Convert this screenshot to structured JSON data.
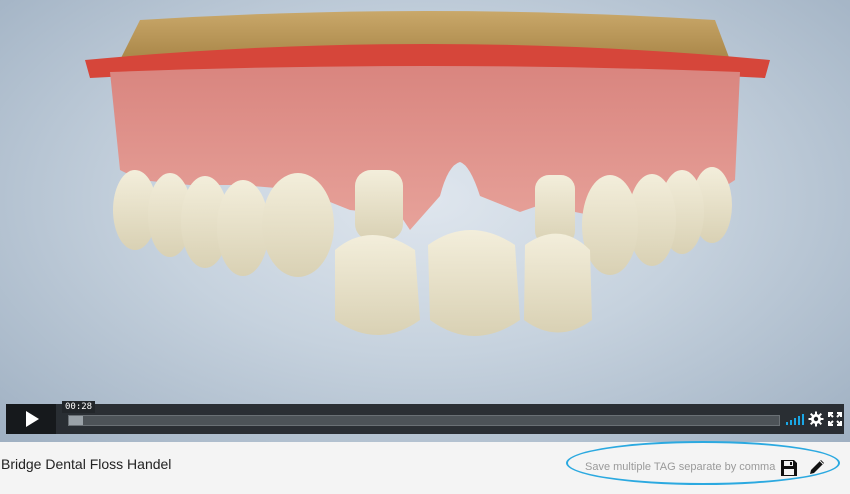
{
  "player": {
    "current_time": "00:28",
    "progress_fraction": 0.02,
    "volume_level": 1.0
  },
  "video": {
    "title": "Bridge Dental Floss Handel"
  },
  "tags": {
    "placeholder": "Save multiple TAG separate by comma",
    "value": ""
  },
  "icons": {
    "play": "play-icon",
    "volume": "volume-icon",
    "settings": "gear-icon",
    "fullscreen": "fullscreen-icon",
    "save": "floppy-disk-icon",
    "edit": "pencil-icon"
  },
  "colors": {
    "accent": "#2ba9e0",
    "control_bar": "#1e2226"
  }
}
